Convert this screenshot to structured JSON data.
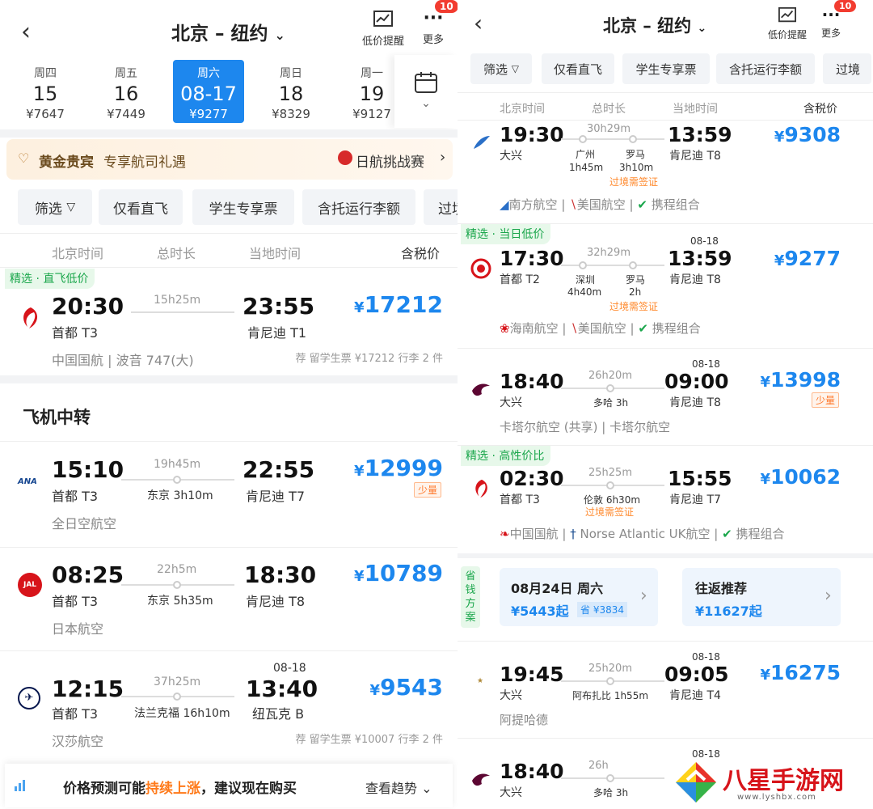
{
  "left": {
    "header": {
      "route": "北京 – 纽约",
      "alert_label": "低价提醒",
      "more_label": "更多",
      "badge": "10"
    },
    "dates": [
      {
        "wd": "周四",
        "day": "15",
        "price": "¥7647"
      },
      {
        "wd": "周五",
        "day": "16",
        "price": "¥7449"
      },
      {
        "wd": "周六",
        "day": "08-17",
        "price": "¥9277"
      },
      {
        "wd": "周日",
        "day": "18",
        "price": "¥8329"
      },
      {
        "wd": "周一",
        "day": "19",
        "price": "¥9127"
      }
    ],
    "banner": {
      "vip": "黄金贵宾",
      "vip_desc": "专享航司礼遇",
      "promo": "日航挑战赛"
    },
    "filters": [
      "筛选",
      "仅看直飞",
      "学生专享票",
      "含托运行李额",
      "过境"
    ],
    "cols": {
      "dep": "北京时间",
      "dur": "总时长",
      "arr": "当地时间",
      "price": "含税价"
    },
    "direct": {
      "tag": "精选 · 直飞低价",
      "dep": "20:30",
      "dep_ap": "首都 T3",
      "dur": "15h25m",
      "arr": "23:55",
      "arr_ap": "肯尼迪 T1",
      "price": "17212",
      "airline": "中国国航 | 波音 747(大)",
      "note": "荐 留学生票 ¥17212 行李 2 件"
    },
    "section": "飞机中转",
    "flights": [
      {
        "dep": "15:10",
        "dep_ap": "首都 T3",
        "dur": "19h45m",
        "stop": "东京 3h10m",
        "arr": "22:55",
        "arr_ap": "肯尼迪 T7",
        "price": "12999",
        "low": "少量",
        "airline": "全日空航空"
      },
      {
        "dep": "08:25",
        "dep_ap": "首都 T3",
        "dur": "22h5m",
        "stop": "东京 5h35m",
        "arr": "18:30",
        "arr_ap": "肯尼迪 T8",
        "price": "10789",
        "airline": "日本航空"
      },
      {
        "dep": "12:15",
        "dep_ap": "首都 T3",
        "dur": "37h25m",
        "stop": "法兰克福 16h10m",
        "arr": "13:40",
        "arr_date": "08-18",
        "arr_ap": "纽瓦克 B",
        "price": "9543",
        "airline": "汉莎航空",
        "note": "荐 留学生票 ¥10007 行李 2 件"
      }
    ],
    "footer": {
      "text1": "价格预测可能",
      "hl": "持续上涨",
      "text2": "，建议现在购买",
      "link": "查看趋势"
    }
  },
  "right": {
    "header": {
      "route": "北京 – 纽约",
      "alert_label": "低价提醒",
      "more_label": "更多",
      "badge": "10"
    },
    "filters": [
      "筛选",
      "仅看直飞",
      "学生专享票",
      "含托运行李额",
      "过境"
    ],
    "cols": {
      "dep": "北京时间",
      "dur": "总时长",
      "arr": "当地时间",
      "price": "含税价"
    },
    "f1": {
      "dep": "19:30",
      "dep_ap": "大兴",
      "dur": "30h29m",
      "s1": "广州",
      "s1t": "1h45m",
      "s2": "罗马",
      "s2t": "3h10m",
      "visa": "过境需签证",
      "arr": "13:59",
      "arr_ap": "肯尼迪 T8",
      "price": "9308",
      "a1": "南方航空",
      "a2": "美国航空",
      "a3": "携程组合"
    },
    "f2": {
      "tag": "精选 · 当日低价",
      "dep": "17:30",
      "dep_ap": "首都 T2",
      "dur": "32h29m",
      "s1": "深圳",
      "s1t": "4h40m",
      "s2": "罗马",
      "s2t": "2h",
      "visa": "过境需签证",
      "arr": "13:59",
      "arr_date": "08-18",
      "arr_ap": "肯尼迪 T8",
      "price": "9277",
      "a1": "海南航空",
      "a2": "美国航空",
      "a3": "携程组合"
    },
    "f3": {
      "dep": "18:40",
      "dep_ap": "大兴",
      "dur": "26h20m",
      "stop": "多哈 3h",
      "arr": "09:00",
      "arr_date": "08-18",
      "arr_ap": "肯尼迪 T8",
      "price": "13998",
      "low": "少量",
      "airline": "卡塔尔航空 (共享) | 卡塔尔航空"
    },
    "f4": {
      "tag": "精选 · 高性价比",
      "dep": "02:30",
      "dep_ap": "首都 T3",
      "dur": "25h25m",
      "stop": "伦敦 6h30m",
      "visa": "过境需签证",
      "arr": "15:55",
      "arr_ap": "肯尼迪 T7",
      "price": "10062",
      "a1": "中国国航",
      "a2": "Norse Atlantic UK航空",
      "a3": "携程组合"
    },
    "save": {
      "side": [
        "省",
        "钱",
        "方",
        "案"
      ],
      "c1_title": "08月24日 周六",
      "c1_price": "¥5443起",
      "c1_save": "省 ¥3834",
      "c2_title": "往返推荐",
      "c2_price": "¥11627起"
    },
    "f5": {
      "dep": "19:45",
      "dep_ap": "大兴",
      "dur": "25h20m",
      "stop": "阿布扎比 1h55m",
      "arr": "09:05",
      "arr_date": "08-18",
      "arr_ap": "肯尼迪 T4",
      "price": "16275",
      "airline": "阿提哈德"
    },
    "f6": {
      "dep": "18:40",
      "dep_ap": "大兴",
      "dur": "26h",
      "stop": "多哈 3h",
      "arr_date": "08-18"
    },
    "watermark": {
      "brand": "八星手游网",
      "url": "www.lyshbx.com"
    }
  }
}
